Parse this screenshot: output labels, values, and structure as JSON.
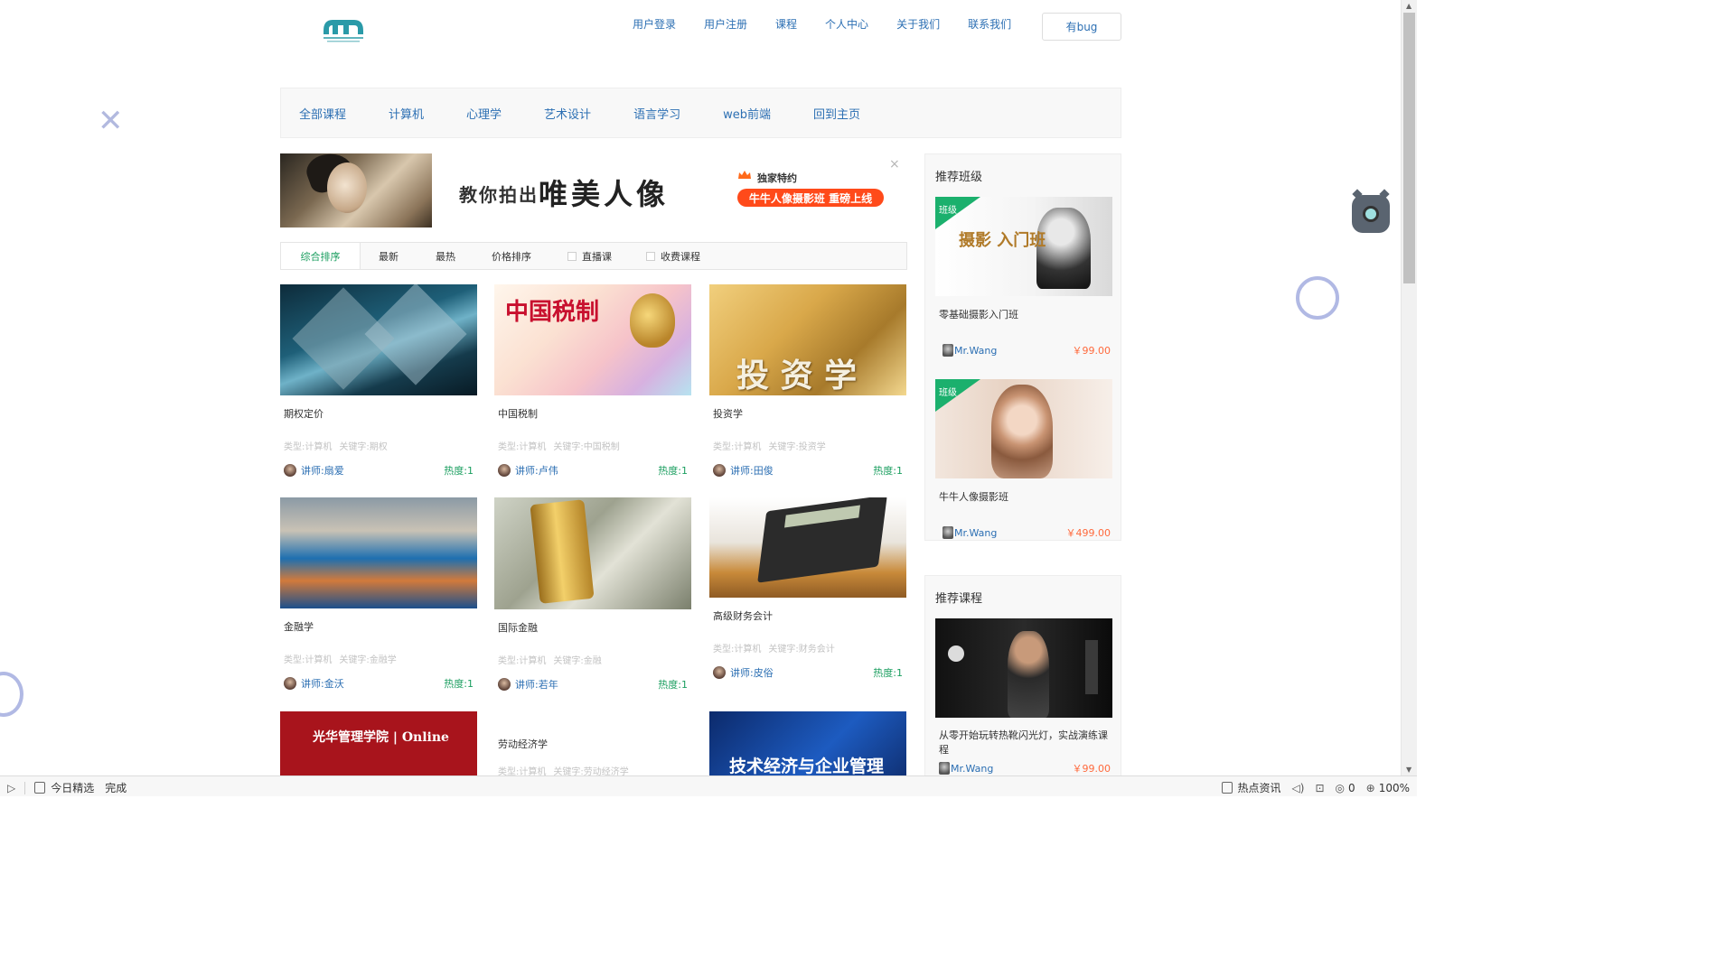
{
  "header": {
    "nav": [
      "用户登录",
      "用户注册",
      "课程",
      "个人中心",
      "关于我们",
      "联系我们"
    ],
    "bug_button": "有bug"
  },
  "categories": [
    "全部课程",
    "计算机",
    "心理学",
    "艺术设计",
    "语言学习",
    "web前端",
    "回到主页"
  ],
  "banner": {
    "slogan_prefix": "教你拍出",
    "slogan_main": "唯美人像",
    "exclusive": "独家特约",
    "pill": "牛牛人像摄影班 重磅上线",
    "close": "×"
  },
  "sort_tabs": {
    "comprehensive": "综合排序",
    "newest": "最新",
    "hottest": "最热",
    "price": "价格排序",
    "live": "直播课",
    "paid": "收费课程"
  },
  "courses": [
    {
      "title": "期权定价",
      "type": "类型:计算机",
      "keyword": "关键字:期权",
      "teacher": "讲师:扇爱",
      "heat": "热度:1"
    },
    {
      "title": "中国税制",
      "type": "类型:计算机",
      "keyword": "关键字:中国税制",
      "teacher": "讲师:卢伟",
      "heat": "热度:1",
      "img_text": "中国税制"
    },
    {
      "title": "投资学",
      "type": "类型:计算机",
      "keyword": "关键字:投资学",
      "teacher": "讲师:田俊",
      "heat": "热度:1",
      "img_text": "投 资 学"
    },
    {
      "title": "金融学",
      "type": "类型:计算机",
      "keyword": "关键字:金融学",
      "teacher": "讲师:金沃",
      "heat": "热度:1"
    },
    {
      "title": "国际金融",
      "type": "类型:计算机",
      "keyword": "关键字:金融",
      "teacher": "讲师:若年",
      "heat": "热度:1"
    },
    {
      "title": "高级财务会计",
      "type": "类型:计算机",
      "keyword": "关键字:财务会计",
      "teacher": "讲师:皮俗",
      "heat": "热度:1"
    },
    {
      "title": "",
      "img_text": "光华管理学院 | Online"
    },
    {
      "title": "劳动经济学",
      "type": "类型:计算机",
      "keyword": "关键字:劳动经济学"
    },
    {
      "title": "",
      "img_text": "技术经济与企业管理"
    }
  ],
  "sidebar": {
    "recommended_classes": {
      "heading": "推荐班级",
      "items": [
        {
          "ribbon": "班级",
          "name": "零基础摄影入门班",
          "teacher": "Mr.Wang",
          "price": "￥99.00",
          "img_text": "摄影 入门班"
        },
        {
          "ribbon": "班级",
          "name": "牛牛人像摄影班",
          "teacher": "Mr.Wang",
          "price": "￥499.00"
        }
      ]
    },
    "recommended_courses": {
      "heading": "推荐课程",
      "items": [
        {
          "name": "从零开始玩转热靴闪光灯，实战演练课程",
          "teacher": "Mr.Wang",
          "price": "￥99.00"
        }
      ]
    }
  },
  "status_bar": {
    "today": "今日精选",
    "done": "完成",
    "news": "热点资讯",
    "count": "0",
    "zoom": "100%"
  }
}
